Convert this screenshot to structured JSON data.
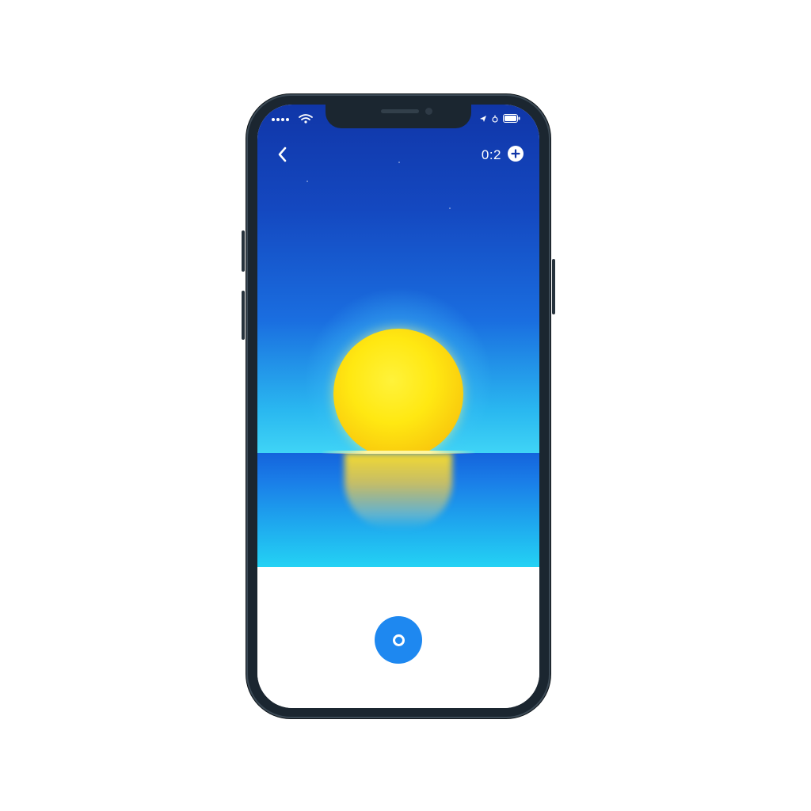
{
  "status_bar": {
    "signal_icon": "signal-dots-icon",
    "wifi_icon": "wifi-icon",
    "battery_icon": "battery-icon"
  },
  "top_bar": {
    "back_icon": "chevron-left-icon",
    "counter_text": "0:2",
    "add_icon": "plus-circle-icon"
  },
  "scene": {
    "description_icon": "sunset-scene",
    "sky_color_top": "#1036a8",
    "sky_color_bottom": "#3fd4f6",
    "sun_color": "#ffe812",
    "sea_color": "#1a7ee8"
  },
  "bottom": {
    "capture_icon": "record-circle-icon",
    "capture_color": "#1e88f0"
  }
}
